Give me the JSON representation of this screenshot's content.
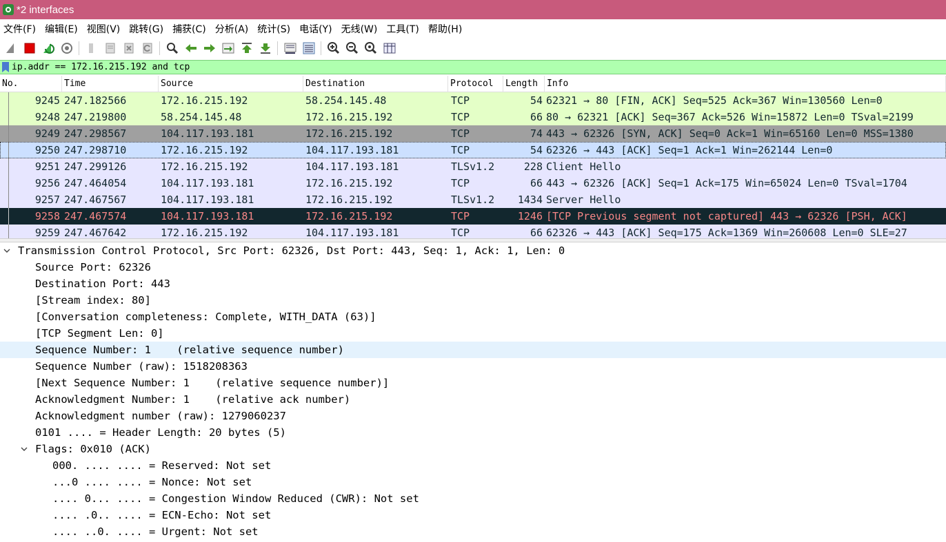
{
  "window": {
    "title": "*2 interfaces"
  },
  "menu": [
    "文件(F)",
    "编辑(E)",
    "视图(V)",
    "跳转(G)",
    "捕获(C)",
    "分析(A)",
    "统计(S)",
    "电话(Y)",
    "无线(W)",
    "工具(T)",
    "帮助(H)"
  ],
  "toolbar": {
    "icons": [
      "shark-fin-icon",
      "stop-capture-icon",
      "restart-capture-icon",
      "capture-options-icon",
      "open-file-icon",
      "save-file-icon",
      "close-file-icon",
      "reload-file-icon",
      "find-packet-icon",
      "go-back-icon",
      "go-forward-icon",
      "go-to-packet-icon",
      "go-first-icon",
      "go-last-icon",
      "autoscroll-icon",
      "colorize-icon",
      "zoom-in-icon",
      "zoom-out-icon",
      "normal-size-icon",
      "resize-columns-icon"
    ]
  },
  "filter": {
    "value": "ip.addr == 172.16.215.192 and tcp"
  },
  "packet_list": {
    "columns": [
      "No.",
      "Time",
      "Source",
      "Destination",
      "Protocol",
      "Length",
      "Info"
    ],
    "rows": [
      {
        "no": "9245",
        "time": "247.182566",
        "src": "172.16.215.192",
        "dst": "58.254.145.48",
        "proto": "TCP",
        "len": "54",
        "info": "62321 → 80 [FIN, ACK] Seq=525 Ack=367 Win=130560 Len=0",
        "bg": "#e4ffc7",
        "fg": "#12272e"
      },
      {
        "no": "9248",
        "time": "247.219800",
        "src": "58.254.145.48",
        "dst": "172.16.215.192",
        "proto": "TCP",
        "len": "66",
        "info": "80 → 62321 [ACK] Seq=367 Ack=526 Win=15872 Len=0 TSval=2199",
        "bg": "#e4ffc7",
        "fg": "#12272e"
      },
      {
        "no": "9249",
        "time": "247.298567",
        "src": "104.117.193.181",
        "dst": "172.16.215.192",
        "proto": "TCP",
        "len": "74",
        "info": "443 → 62326 [SYN, ACK] Seq=0 Ack=1 Win=65160 Len=0 MSS=1380",
        "bg": "#a0a0a0",
        "fg": "#12272e"
      },
      {
        "no": "9250",
        "time": "247.298710",
        "src": "172.16.215.192",
        "dst": "104.117.193.181",
        "proto": "TCP",
        "len": "54",
        "info": "62326 → 443 [ACK] Seq=1 Ack=1 Win=262144 Len=0",
        "bg": "#cce0ff",
        "fg": "#12272e"
      },
      {
        "no": "9251",
        "time": "247.299126",
        "src": "172.16.215.192",
        "dst": "104.117.193.181",
        "proto": "TLSv1.2",
        "len": "228",
        "info": "Client Hello",
        "bg": "#e7e6ff",
        "fg": "#12272e"
      },
      {
        "no": "9256",
        "time": "247.464054",
        "src": "104.117.193.181",
        "dst": "172.16.215.192",
        "proto": "TCP",
        "len": "66",
        "info": "443 → 62326 [ACK] Seq=1 Ack=175 Win=65024 Len=0 TSval=1704",
        "bg": "#e7e6ff",
        "fg": "#12272e"
      },
      {
        "no": "9257",
        "time": "247.467567",
        "src": "104.117.193.181",
        "dst": "172.16.215.192",
        "proto": "TLSv1.2",
        "len": "1434",
        "info": "Server Hello",
        "bg": "#e7e6ff",
        "fg": "#12272e"
      },
      {
        "no": "9258",
        "time": "247.467574",
        "src": "104.117.193.181",
        "dst": "172.16.215.192",
        "proto": "TCP",
        "len": "1246",
        "info": "[TCP Previous segment not captured] 443 → 62326 [PSH, ACK]",
        "bg": "#12272e",
        "fg": "#f78787"
      },
      {
        "no": "9259",
        "time": "247.467642",
        "src": "172.16.215.192",
        "dst": "104.117.193.181",
        "proto": "TCP",
        "len": "66",
        "info": "62326 → 443 [ACK] Seq=175 Ack=1369 Win=260608 Len=0 SLE=27",
        "bg": "#e7e6ff",
        "fg": "#12272e"
      }
    ]
  },
  "details": [
    {
      "indent": 0,
      "expander": "expanded",
      "text": "Transmission Control Protocol, Src Port: 62326, Dst Port: 443, Seq: 1, Ack: 1, Len: 0"
    },
    {
      "indent": 1,
      "text": "Source Port: 62326"
    },
    {
      "indent": 1,
      "text": "Destination Port: 443"
    },
    {
      "indent": 1,
      "text": "[Stream index: 80]"
    },
    {
      "indent": 1,
      "text": "[Conversation completeness: Complete, WITH_DATA (63)]"
    },
    {
      "indent": 1,
      "text": "[TCP Segment Len: 0]"
    },
    {
      "indent": 1,
      "text": "Sequence Number: 1    (relative sequence number)",
      "selected": true
    },
    {
      "indent": 1,
      "text": "Sequence Number (raw): 1518208363"
    },
    {
      "indent": 1,
      "text": "[Next Sequence Number: 1    (relative sequence number)]"
    },
    {
      "indent": 1,
      "text": "Acknowledgment Number: 1    (relative ack number)"
    },
    {
      "indent": 1,
      "text": "Acknowledgment number (raw): 1279060237"
    },
    {
      "indent": 1,
      "text": "0101 .... = Header Length: 20 bytes (5)"
    },
    {
      "indent": 1,
      "expander": "expanded",
      "text": "Flags: 0x010 (ACK)"
    },
    {
      "indent": 2,
      "text": "000. .... .... = Reserved: Not set"
    },
    {
      "indent": 2,
      "text": "...0 .... .... = Nonce: Not set"
    },
    {
      "indent": 2,
      "text": ".... 0... .... = Congestion Window Reduced (CWR): Not set"
    },
    {
      "indent": 2,
      "text": ".... .0.. .... = ECN-Echo: Not set"
    },
    {
      "indent": 2,
      "text": ".... ..0. .... = Urgent: Not set"
    }
  ]
}
